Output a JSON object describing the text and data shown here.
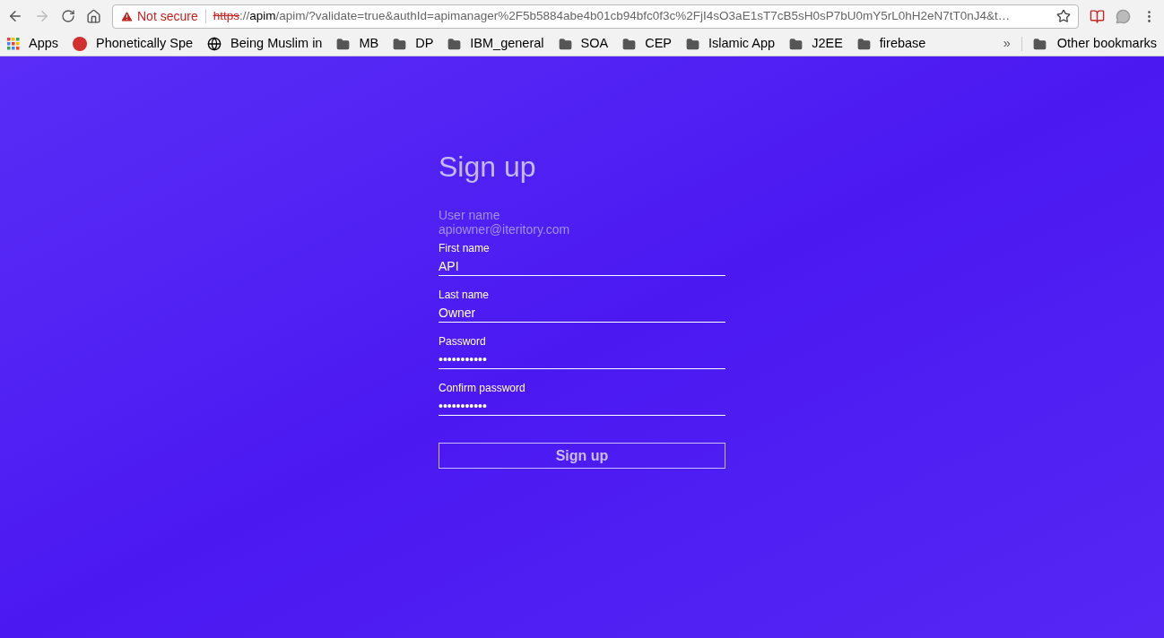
{
  "browser": {
    "security": "Not secure",
    "url": {
      "scheme": "https",
      "separator": "://",
      "host": "apim",
      "rest": "/apim/?validate=true&authId=apimanager%2F5b5884abe4b01cb94bfc0f3c%2FjI4sO3aE1sT7cB5sH0sP7bU0mY5rL0hH2eN7tT0nJ4&t…"
    },
    "bookmarks": [
      {
        "kind": "apps",
        "label": "Apps"
      },
      {
        "kind": "site",
        "label": "Phonetically Spe"
      },
      {
        "kind": "globe",
        "label": "Being Muslim in"
      },
      {
        "kind": "folder",
        "label": "MB"
      },
      {
        "kind": "folder",
        "label": "DP"
      },
      {
        "kind": "folder",
        "label": "IBM_general"
      },
      {
        "kind": "folder",
        "label": "SOA"
      },
      {
        "kind": "folder",
        "label": "CEP"
      },
      {
        "kind": "folder",
        "label": "Islamic App"
      },
      {
        "kind": "folder",
        "label": "J2EE"
      },
      {
        "kind": "folder",
        "label": "firebase"
      }
    ],
    "overflow": "»",
    "other_bookmarks": "Other bookmarks"
  },
  "form": {
    "title": "Sign up",
    "user_name": {
      "label": "User name",
      "value": "apiowner@iteritory.com"
    },
    "fields": [
      {
        "label": "First name",
        "value": "API"
      },
      {
        "label": "Last name",
        "value": "Owner"
      },
      {
        "label": "Password",
        "value": "•••••••••••"
      },
      {
        "label": "Confirm password",
        "value": "•••••••••••"
      }
    ],
    "submit": "Sign up"
  }
}
